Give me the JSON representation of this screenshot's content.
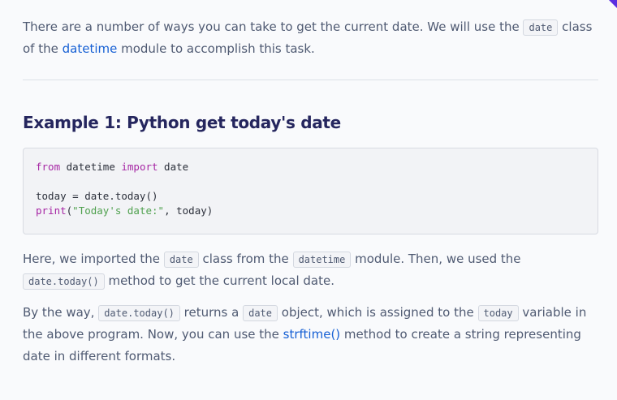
{
  "intro": {
    "t1": "There are a number of ways you can take to get the current date. We will use the ",
    "code1": "date",
    "t2": " class of the ",
    "link1": "datetime",
    "t3": " module to accomplish this task."
  },
  "example": {
    "heading": "Example 1: Python get today's date"
  },
  "code": {
    "l1_kw1": "from",
    "l1_mid": " datetime ",
    "l1_kw2": "import",
    "l1_end": " date",
    "l3": "today = date.today()",
    "l4_kw": "print",
    "l4_open": "(",
    "l4_str": "\"Today's date:\"",
    "l4_end": ", today)"
  },
  "explanation": {
    "t1": "Here, we imported the ",
    "code1": "date",
    "t2": " class from the ",
    "code2": "datetime",
    "t3": " module. Then, we used the ",
    "code3": "date.today()",
    "t4": " method to get the current local date."
  },
  "byway": {
    "t1": "By the way, ",
    "code1": "date.today()",
    "t2": " returns a ",
    "code2": "date",
    "t3": " object, which is assigned to the ",
    "code3": "today",
    "t4": " variable in the above program. Now, you can use the ",
    "link1": "strftime()",
    "t5": " method to create a string representing date in different formats."
  }
}
